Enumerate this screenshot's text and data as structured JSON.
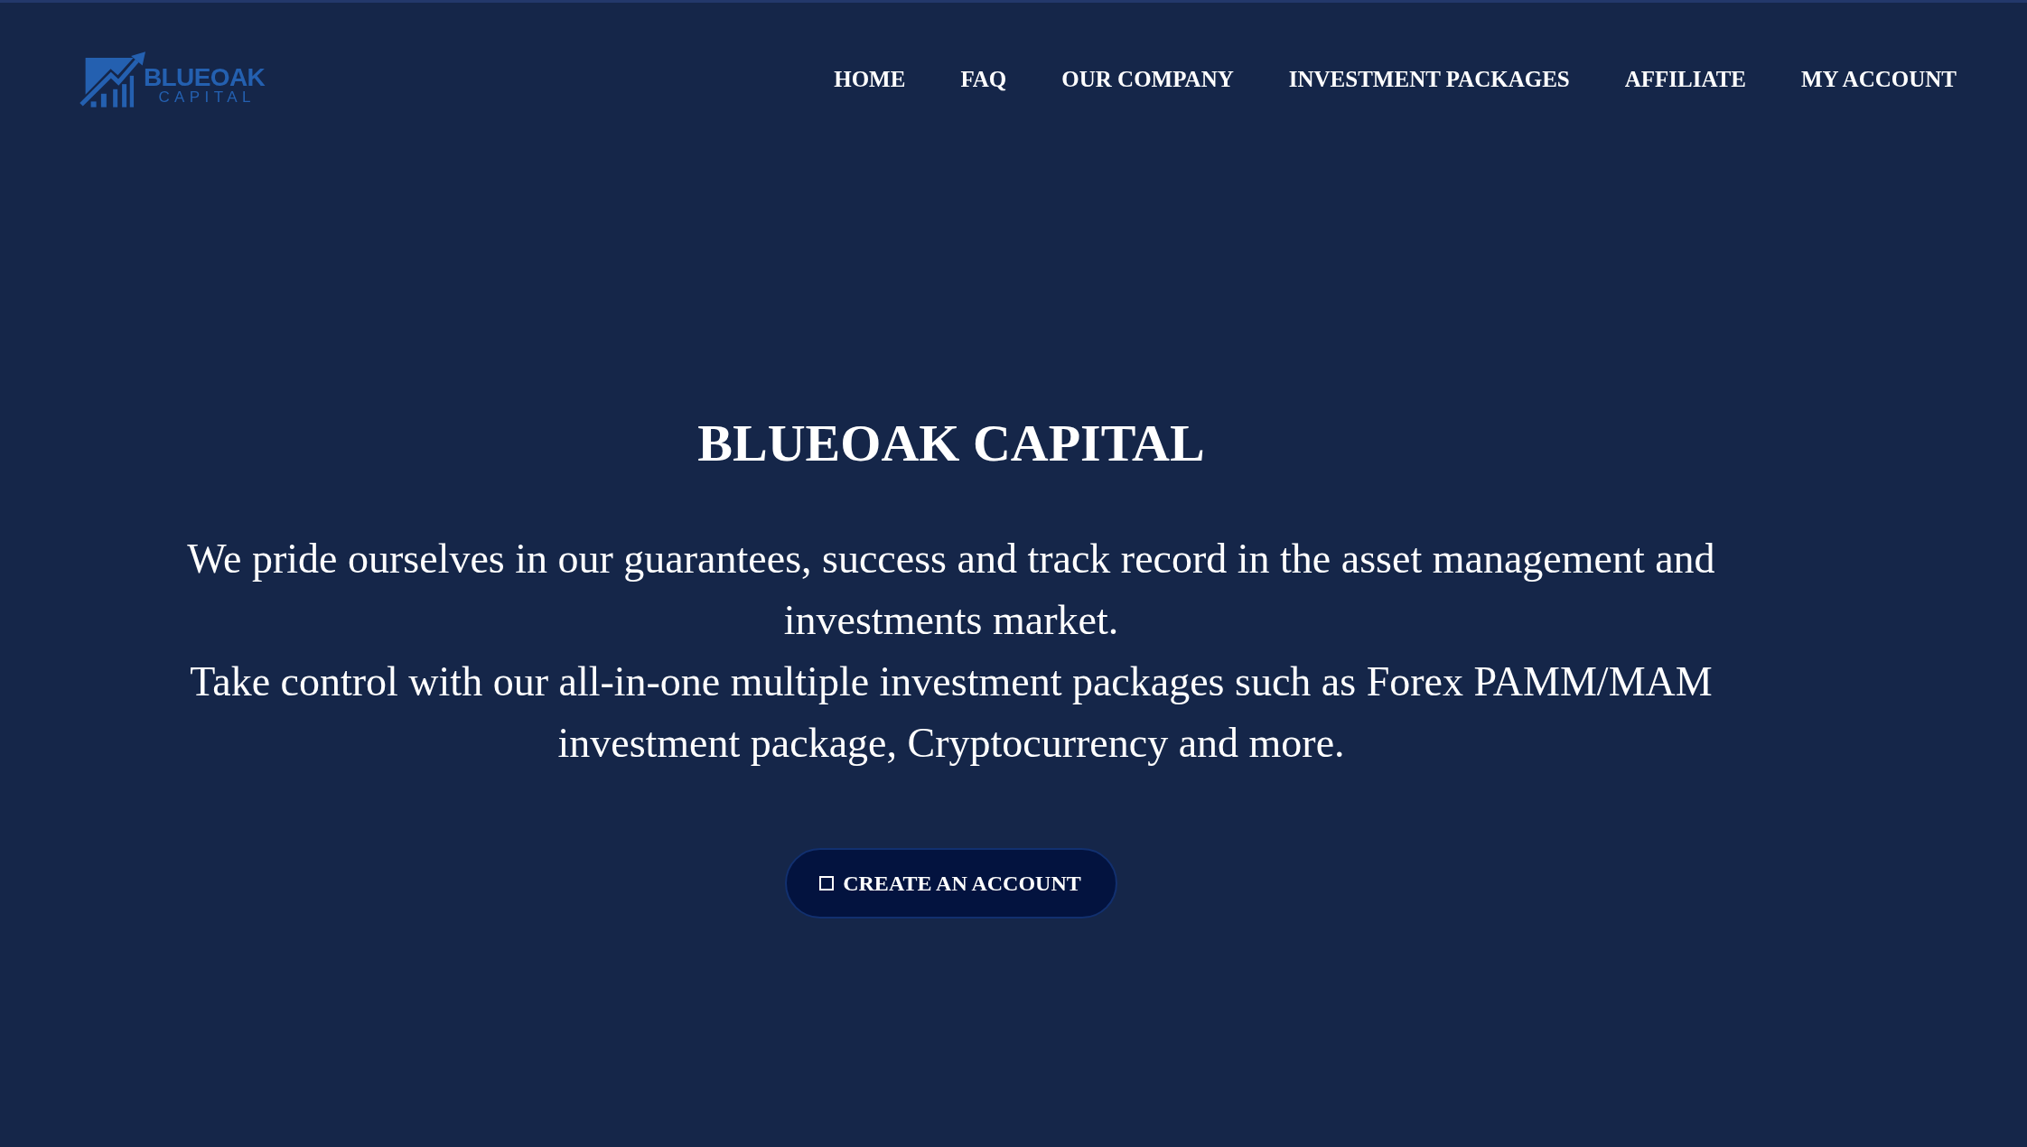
{
  "header": {
    "logo": {
      "name": "BLUEOAK",
      "tagline": "CAPITAL"
    },
    "nav": [
      "HOME",
      "FAQ",
      "OUR COMPANY",
      "INVESTMENT PACKAGES",
      "AFFILIATE",
      "MY ACCOUNT"
    ]
  },
  "hero": {
    "title": "BLUEOAK CAPITAL",
    "description": [
      "We pride ourselves in our guarantees, success and track record in the asset management and investments market.",
      "Take control with our all-in-one multiple investment packages such as Forex PAMM/MAM investment package, Cryptocurrency and more."
    ],
    "button": {
      "label": "CREATE AN ACCOUNT"
    }
  }
}
